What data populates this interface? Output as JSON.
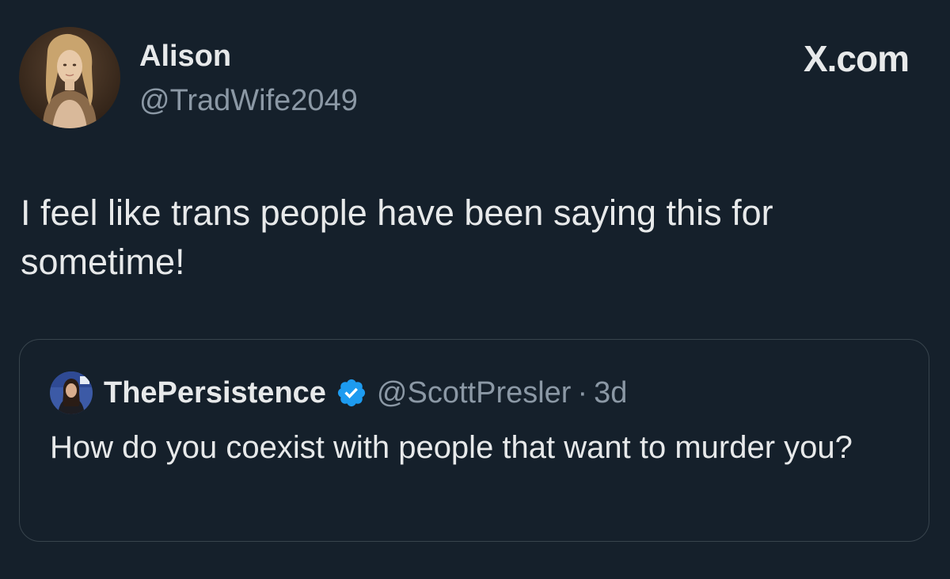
{
  "watermark": "X.com",
  "tweet": {
    "author": {
      "name": "Alison",
      "handle": "@TradWife2049"
    },
    "text": "I feel like trans people have been saying this for sometime!",
    "quoted": {
      "author": {
        "name": "ThePersistence",
        "handle": "@ScottPresler",
        "verified": true
      },
      "separator": "·",
      "time": "3d",
      "text": "How do you coexist with people that want to murder you?"
    }
  },
  "colors": {
    "background": "#15202b",
    "text_primary": "#e7e9ea",
    "text_secondary": "#8b98a5",
    "border": "#38444d",
    "verified_blue": "#1d9bf0"
  }
}
